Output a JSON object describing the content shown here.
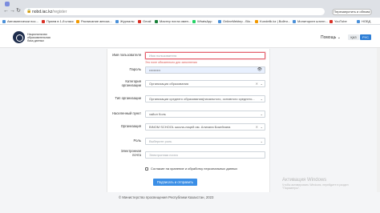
{
  "browser": {
    "tab_title": "",
    "url_host": "nobd.iac.kz",
    "url_path": "/register",
    "update_button": "Перезапустить и обнови"
  },
  "bookmarks": [
    {
      "label": "Автоматически пос...",
      "color": "#4a90d9"
    },
    {
      "label": "Прием в 1-й класс",
      "color": "#d93025"
    },
    {
      "label": "Расписание автоза...",
      "color": "#f29900"
    },
    {
      "label": "Журналы",
      "color": "#4a90d9"
    },
    {
      "label": "Gmail",
      "color": "#d93025"
    },
    {
      "label": "Мастер почта имен...",
      "color": "#188038"
    },
    {
      "label": "WhatsApp",
      "color": "#25d366"
    },
    {
      "label": "ОnlineMektep - Blo...",
      "color": "#4a90d9"
    },
    {
      "label": "Kundelik.kz | Войти...",
      "color": "#f29900"
    },
    {
      "label": "Мониторинг штатн...",
      "color": "#4a90d9"
    },
    {
      "label": "YouTube",
      "color": "#d93025"
    },
    {
      "label": "НОБД",
      "color": "#4a90d9"
    }
  ],
  "header": {
    "org_line1": "Национальная",
    "org_line2": "образовательная",
    "org_line3": "база данных",
    "help_label": "Помощь",
    "lang_kz": "ҚАЗ",
    "lang_ru": "РУС"
  },
  "form": {
    "username": {
      "label": "Имя пользователя",
      "placeholder": "Имя пользователя",
      "error": "Это поле обязательно для заполнения"
    },
    "password": {
      "label": "Пароль",
      "value": "••••••••••"
    },
    "org_category": {
      "label1": "Категория",
      "label2": "организации",
      "value": "Организация образования"
    },
    "org_type": {
      "label": "Тип организации",
      "value": "Организации среднего образования(начального, основного среднего..."
    },
    "locality": {
      "label": "Населенный пункт",
      "value": "хайол Коль"
    },
    "organization": {
      "label": "Организация",
      "value": "BINOM SCHOOL школа-лицей им. Алихана Бокейхана"
    },
    "role": {
      "label": "Роль",
      "placeholder": "Выберите роль"
    },
    "email": {
      "label1": "Электронная",
      "label2": "почта",
      "placeholder": "Электронная почта"
    },
    "consent": "Согласие на хранение и обработку персональных данных",
    "submit": "Подписать и отправить"
  },
  "footer": {
    "copyright": "© Министерство просвещения Республики Казахстан, 2023"
  },
  "watermark": {
    "title": "Активация Windows",
    "line1": "Чтобы активировать Windows, перейдите в раздел",
    "line2": "\"Параметры\"."
  },
  "colors": {
    "accent": "#3a8ee6",
    "error": "#d9534f",
    "logo": "#1d2c4c"
  }
}
